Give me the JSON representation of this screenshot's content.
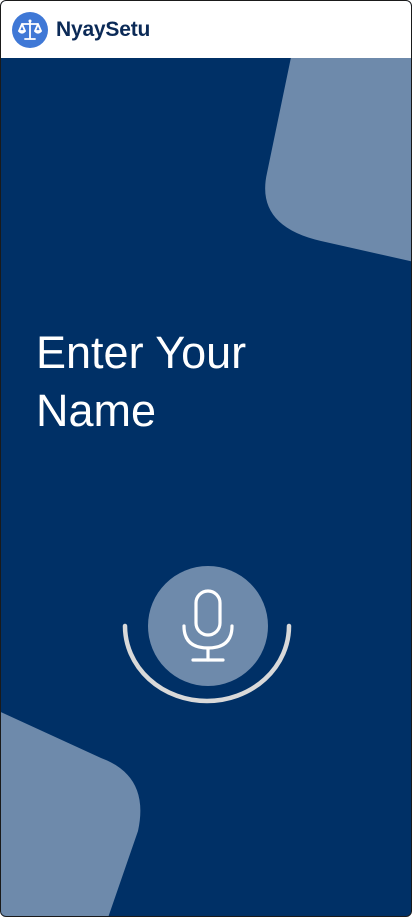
{
  "app": {
    "brand_name": "NyaySetu",
    "logo_icon": "scales-of-justice-icon"
  },
  "screen": {
    "title": "Enter Your Name"
  },
  "voice_input": {
    "icon": "microphone-icon"
  },
  "colors": {
    "background": "#003066",
    "decor_shape": "#6e8aab",
    "mic_button": "#6e8aab",
    "arc": "#d9d9d9",
    "logo_badge": "#3f78d6",
    "brand_text": "#0b2a57"
  }
}
